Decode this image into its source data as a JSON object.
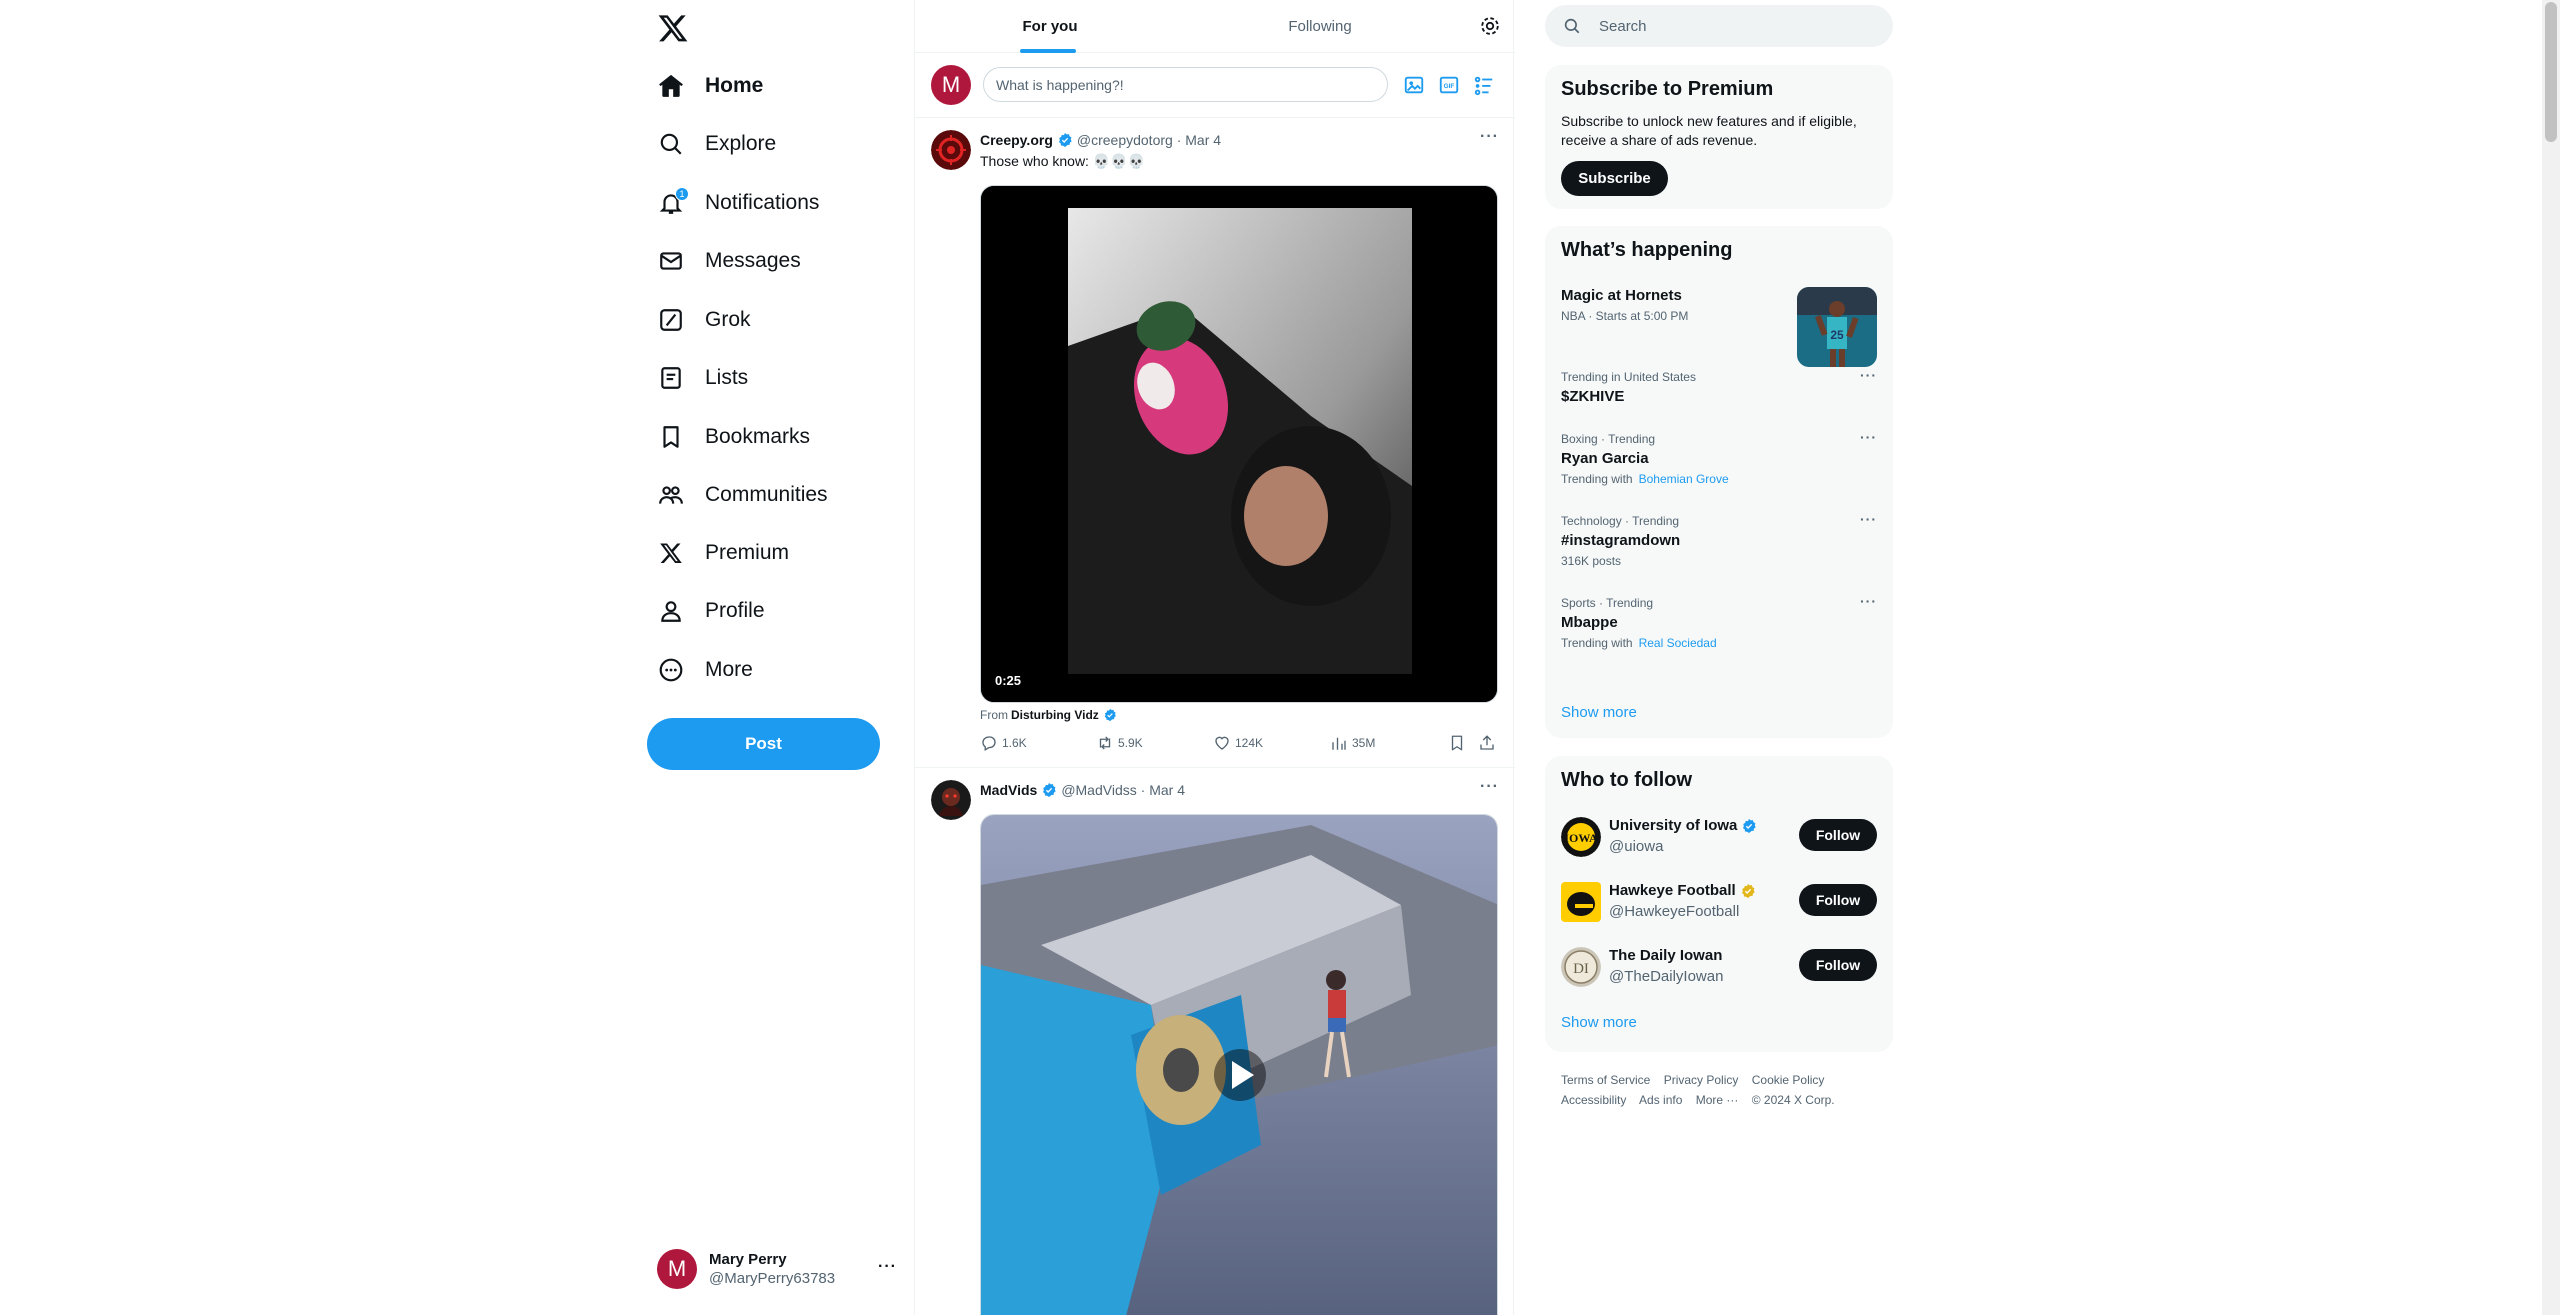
{
  "nav": {
    "items": [
      {
        "label": "Home",
        "icon": "home-icon"
      },
      {
        "label": "Explore",
        "icon": "search-icon"
      },
      {
        "label": "Notifications",
        "icon": "bell-icon",
        "badge": "1"
      },
      {
        "label": "Messages",
        "icon": "envelope-icon"
      },
      {
        "label": "Grok",
        "icon": "grok-icon"
      },
      {
        "label": "Lists",
        "icon": "list-icon"
      },
      {
        "label": "Bookmarks",
        "icon": "bookmark-icon"
      },
      {
        "label": "Communities",
        "icon": "people-icon"
      },
      {
        "label": "Premium",
        "icon": "x-logo-icon"
      },
      {
        "label": "Profile",
        "icon": "person-icon"
      },
      {
        "label": "More",
        "icon": "more-circle-icon"
      }
    ],
    "post_label": "Post"
  },
  "account": {
    "initial": "M",
    "name": "Mary Perry",
    "handle": "@MaryPerry63783",
    "more": "···"
  },
  "tabs": {
    "for_you": "For you",
    "following": "Following"
  },
  "composer": {
    "initial": "M",
    "placeholder": "What is happening?!"
  },
  "tweets": [
    {
      "name": "Creepy.org",
      "handle": "@creepydotorg",
      "date": "Mar 4",
      "text": "Those who know: 💀💀💀",
      "duration": "0:25",
      "from_prefix": "From",
      "from_name": "Disturbing Vidz",
      "replies": "1.6K",
      "reposts": "5.9K",
      "likes": "124K",
      "views": "35M"
    },
    {
      "name": "MadVids",
      "handle": "@MadVidss",
      "date": "Mar 4"
    }
  ],
  "search": {
    "placeholder": "Search"
  },
  "premium": {
    "title": "Subscribe to Premium",
    "description": "Subscribe to unlock new features and if eligible, receive a share of ads revenue.",
    "button": "Subscribe"
  },
  "happening": {
    "title": "What’s happening",
    "event": {
      "title": "Magic at Hornets",
      "context": "NBA · Starts at 5:00 PM"
    },
    "trends": [
      {
        "context": "Trending in United States",
        "title": "$ZKHIVE",
        "sub_prefix": "",
        "sub_link": ""
      },
      {
        "context": "Boxing · Trending",
        "title": "Ryan Garcia",
        "sub_prefix": "Trending with",
        "sub_link": "Bohemian Grove"
      },
      {
        "context": "Technology · Trending",
        "title": "#instagramdown",
        "sub_prefix": "316K posts",
        "sub_link": ""
      },
      {
        "context": "Sports · Trending",
        "title": "Mbappe",
        "sub_prefix": "Trending with",
        "sub_link": "Real Sociedad"
      }
    ],
    "show_more": "Show more"
  },
  "who_to_follow": {
    "title": "Who to follow",
    "accounts": [
      {
        "name": "University of Iowa",
        "handle": "@uiowa",
        "badge": "blue"
      },
      {
        "name": "Hawkeye Football",
        "handle": "@HawkeyeFootball",
        "badge": "gold"
      },
      {
        "name": "The Daily Iowan",
        "handle": "@TheDailyIowan",
        "badge": ""
      }
    ],
    "follow_label": "Follow",
    "show_more": "Show more"
  },
  "footer": {
    "links": [
      "Terms of Service",
      "Privacy Policy",
      "Cookie Policy",
      "Accessibility",
      "Ads info",
      "More ···",
      "© 2024 X Corp."
    ]
  },
  "colors": {
    "accent": "#1d9bf0",
    "text": "#0f1419",
    "muted": "#536471",
    "avatar": "#b0173c"
  }
}
